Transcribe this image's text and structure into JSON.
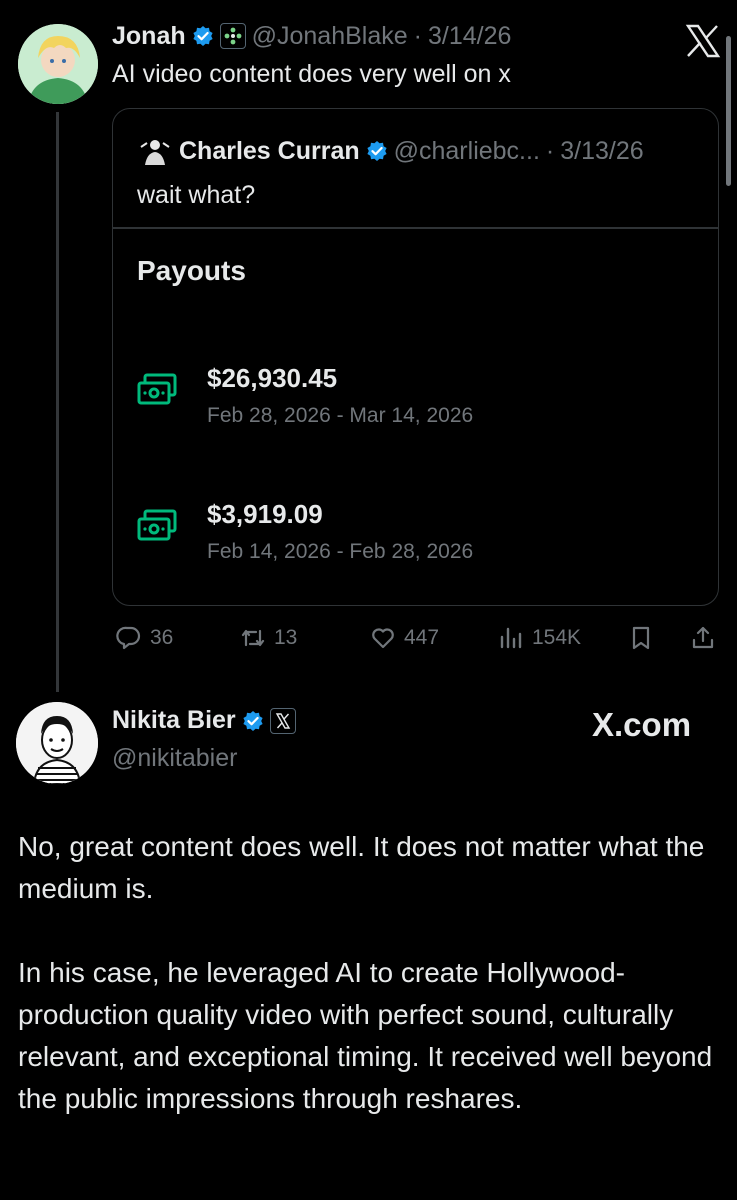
{
  "tweet1": {
    "author_name": "Jonah",
    "handle": "@JonahBlake",
    "date": "3/14/26",
    "text": "AI video content does very well on x"
  },
  "quote": {
    "author_name": "Charles Curran",
    "handle": "@charliebc...",
    "date": "3/13/26",
    "text": "wait what?",
    "payouts_title": "Payouts",
    "payouts": [
      {
        "amount": "$26,930.45",
        "range": "Feb 28, 2026 - Mar 14, 2026"
      },
      {
        "amount": "$3,919.09",
        "range": "Feb 14, 2026 - Feb 28, 2026"
      }
    ]
  },
  "actions": {
    "replies": "36",
    "reposts": "13",
    "likes": "447",
    "views": "154K"
  },
  "tweet2": {
    "author_name": "Nikita Bier",
    "handle": "@nikitabier",
    "brand": "X.com",
    "paragraphs": [
      "No, great content does well. It does not matter what the medium is.",
      "In his case, he leveraged AI to create Hollywood-production quality video with perfect sound, culturally relevant, and exceptional timing. It received well beyond the public impressions through reshares."
    ]
  },
  "colors": {
    "background": "#000000",
    "text": "#e7e9ea",
    "muted": "#71767b",
    "verified": "#1d9bf0",
    "money_green": "#00ba7c",
    "border": "#2f3336"
  },
  "icons": {
    "close": "x-logo-icon",
    "reply": "reply-icon",
    "repost": "repost-icon",
    "like": "heart-icon",
    "views": "views-icon",
    "bookmark": "bookmark-icon",
    "share": "share-icon",
    "money": "money-icon",
    "verified": "verified-badge-icon"
  }
}
